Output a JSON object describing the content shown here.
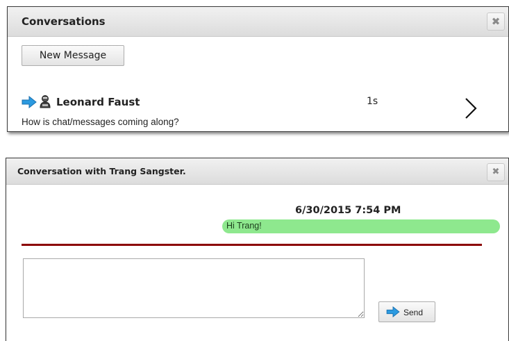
{
  "conversations_panel": {
    "title": "Conversations",
    "close_glyph": "✖",
    "new_message_label": "New Message",
    "items": [
      {
        "name": "Leonard Faust",
        "time": "1s",
        "preview": "How is chat/messages coming along?"
      }
    ]
  },
  "chat_panel": {
    "title": "Conversation with Trang Sangster.",
    "close_glyph": "✖",
    "messages": [
      {
        "timestamp": "6/30/2015 7:54 PM",
        "text": "Hi Trang!"
      }
    ],
    "reply_value": "",
    "send_label": "Send"
  },
  "colors": {
    "accent_arrow": "#2b9ae0",
    "bubble": "#8ee88e",
    "divider": "#8b0000"
  },
  "icons": {
    "status": "arrow-right-icon",
    "avatar": "user-avatar-icon",
    "open": "chevron-right-icon"
  }
}
